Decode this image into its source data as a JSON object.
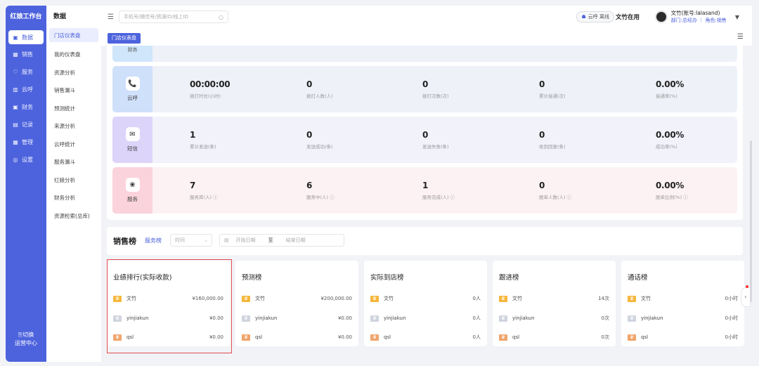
{
  "app": {
    "brand": "红娘工作台"
  },
  "sidebar": {
    "items": [
      {
        "label": "数据",
        "icon": "data-icon",
        "glyph": "▣"
      },
      {
        "label": "销售",
        "icon": "grid-icon",
        "glyph": "▦"
      },
      {
        "label": "服务",
        "icon": "heart-icon",
        "glyph": "♡"
      },
      {
        "label": "云呼",
        "icon": "chart-icon",
        "glyph": "▥"
      },
      {
        "label": "财务",
        "icon": "money-icon",
        "glyph": "▣"
      },
      {
        "label": "记录",
        "icon": "doc-icon",
        "glyph": "▤"
      },
      {
        "label": "管理",
        "icon": "calendar-icon",
        "glyph": "▦"
      },
      {
        "label": "设置",
        "icon": "gear-icon",
        "glyph": "◎"
      }
    ],
    "switch_line1": "切换",
    "switch_line2": "运营中心"
  },
  "subnav": {
    "title": "数据",
    "items": [
      "门店仪表盘",
      "我的仪表盘",
      "资源分析",
      "销售漏斗",
      "预测统计",
      "来源分析",
      "云呼统计",
      "服务漏斗",
      "红娘分析",
      "财务分析",
      "资源检索(总库)"
    ]
  },
  "topbar": {
    "search_placeholder": "手机号/微信号/资源ID/线上ID",
    "online_status": "云呼 离线",
    "work_status": "文竹在用",
    "user_name": "文竹(账号:lalasand)",
    "user_role": "部门:总经办 ｜ 角色:销售"
  },
  "tabs": {
    "active": "门店仪表盘"
  },
  "stats": {
    "partial_label": "财务",
    "rows": [
      {
        "name": "云呼",
        "icon": "phone-icon",
        "color": "#cfe0fb",
        "bg": "#eef1f8",
        "stats": [
          {
            "value": "00:00:00",
            "label": "拨打时长(小时)"
          },
          {
            "value": "0",
            "label": "拨打人数(人)"
          },
          {
            "value": "0",
            "label": "拨打次数(次)"
          },
          {
            "value": "0",
            "label": "累计接通(次)"
          },
          {
            "value": "0.00%",
            "label": "接通率(%)"
          }
        ]
      },
      {
        "name": "短信",
        "icon": "sms-icon",
        "color": "#ddd4fa",
        "bg": "#f1f2fa",
        "stats": [
          {
            "value": "1",
            "label": "累计发送(条)"
          },
          {
            "value": "0",
            "label": "发送成功(条)"
          },
          {
            "value": "0",
            "label": "发送失败(条)"
          },
          {
            "value": "0",
            "label": "收到回复(条)"
          },
          {
            "value": "0.00%",
            "label": "成功率(%)"
          }
        ]
      },
      {
        "name": "服务",
        "icon": "service-icon",
        "color": "#fbd3dc",
        "bg": "#fdf2f3",
        "stats": [
          {
            "value": "7",
            "label": "服务库(人) ⓘ"
          },
          {
            "value": "6",
            "label": "服务中(人) ⓘ"
          },
          {
            "value": "1",
            "label": "服务完成(人) ⓘ"
          },
          {
            "value": "0",
            "label": "脱单人数(人) ⓘ"
          },
          {
            "value": "0.00%",
            "label": "脱单比例(%) ⓘ"
          }
        ]
      }
    ]
  },
  "rank": {
    "title": "销售榜",
    "tab2": "服务榜",
    "time_placeholder": "时间",
    "start_placeholder": "开始日期",
    "separator": "至",
    "end_placeholder": "结束日期"
  },
  "cards": [
    {
      "title": "业绩排行(实际收款)",
      "rows": [
        {
          "name": "文竹",
          "value": "¥160,000.00"
        },
        {
          "name": "yinjiakun",
          "value": "¥0.00"
        },
        {
          "name": "qsl",
          "value": "¥0.00"
        }
      ]
    },
    {
      "title": "预测榜",
      "rows": [
        {
          "name": "文竹",
          "value": "¥200,000.00"
        },
        {
          "name": "yinjiakun",
          "value": "¥0.00"
        },
        {
          "name": "qsl",
          "value": "¥0.00"
        }
      ]
    },
    {
      "title": "实际到店榜",
      "rows": [
        {
          "name": "文竹",
          "value": "0人"
        },
        {
          "name": "yinjiakun",
          "value": "0人"
        },
        {
          "name": "qsl",
          "value": "0人"
        }
      ]
    },
    {
      "title": "跟进榜",
      "rows": [
        {
          "name": "文竹",
          "value": "14次"
        },
        {
          "name": "yinjiakun",
          "value": "0次"
        },
        {
          "name": "qsl",
          "value": "0次"
        }
      ]
    },
    {
      "title": "通话榜",
      "rows": [
        {
          "name": "文竹",
          "value": "0小时"
        },
        {
          "name": "yinjiakun",
          "value": "0小时"
        },
        {
          "name": "qsl",
          "value": "0小时"
        }
      ]
    }
  ]
}
